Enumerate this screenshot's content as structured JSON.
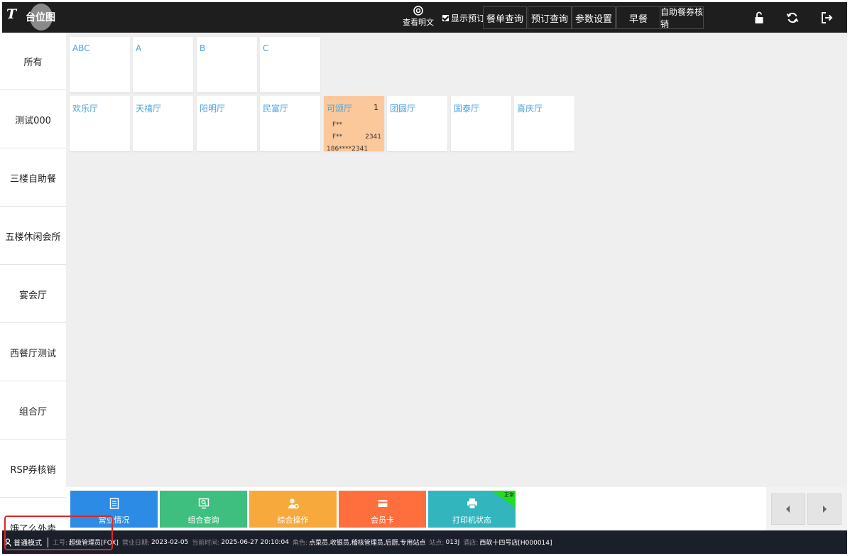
{
  "header": {
    "logo_mark": "T",
    "logo_text": "台位图",
    "view_plain_label": "查看明文",
    "show_reservation_label": "显示预订",
    "buttons": [
      "餐单查询",
      "预订查询",
      "参数设置",
      "早餐",
      "自助餐券核销"
    ]
  },
  "sidebar": {
    "items": [
      "所有",
      "测试000",
      "三楼自助餐",
      "五楼休闲会所",
      "宴会厅",
      "西餐厅测试",
      "组合厅",
      "RSP券核销",
      "饿了么外卖"
    ]
  },
  "tables": {
    "row1": [
      {
        "name": "ABC"
      },
      {
        "name": "A"
      },
      {
        "name": "B"
      },
      {
        "name": "C"
      }
    ],
    "row2": [
      {
        "name": "欢乐厅"
      },
      {
        "name": "天禧厅"
      },
      {
        "name": "阳明厅"
      },
      {
        "name": "民富厅"
      },
      {
        "name": "可颂厅",
        "count": "1",
        "line1": "F**",
        "line2": "F**",
        "line2_value": "2341",
        "line3": "186****2341"
      },
      {
        "name": "团圆厅"
      },
      {
        "name": "国泰厅"
      },
      {
        "name": "喜庆厅"
      }
    ]
  },
  "actions": {
    "items": [
      {
        "label": "营业情况",
        "color": "#2b8be5",
        "icon": "document-icon"
      },
      {
        "label": "组合查询",
        "color": "#3fbf7f",
        "icon": "monitor-search-icon"
      },
      {
        "label": "综合操作",
        "color": "#f7a93b",
        "icon": "user-settings-icon"
      },
      {
        "label": "会员卡",
        "color": "#ff6f3d",
        "icon": "card-icon"
      },
      {
        "label": "打印机状态",
        "color": "#33b5bd",
        "icon": "printer-icon",
        "badge": "正常"
      }
    ]
  },
  "status": {
    "mode": "普通模式",
    "employee_label": "工号:",
    "employee": "超级管理员[FOX]",
    "bizdate_label": "营业日期:",
    "bizdate": "2023-02-05",
    "now_label": "当前时间:",
    "now": "2025-06-27 20:10:04",
    "role_label": "角色:",
    "role": "点菜员,收银员,稽核管理员,后厨,专用站点",
    "station_label": "站点:",
    "station": "013J",
    "hotel_label": "酒店:",
    "hotel": "西软十四号店[H000014]"
  },
  "colors": {
    "topbar": "#1e1e1e",
    "table_name": "#4aa3df",
    "occupied": "#fbc89b",
    "statusbar": "#1b1f2a",
    "highlight": "#e02525"
  }
}
